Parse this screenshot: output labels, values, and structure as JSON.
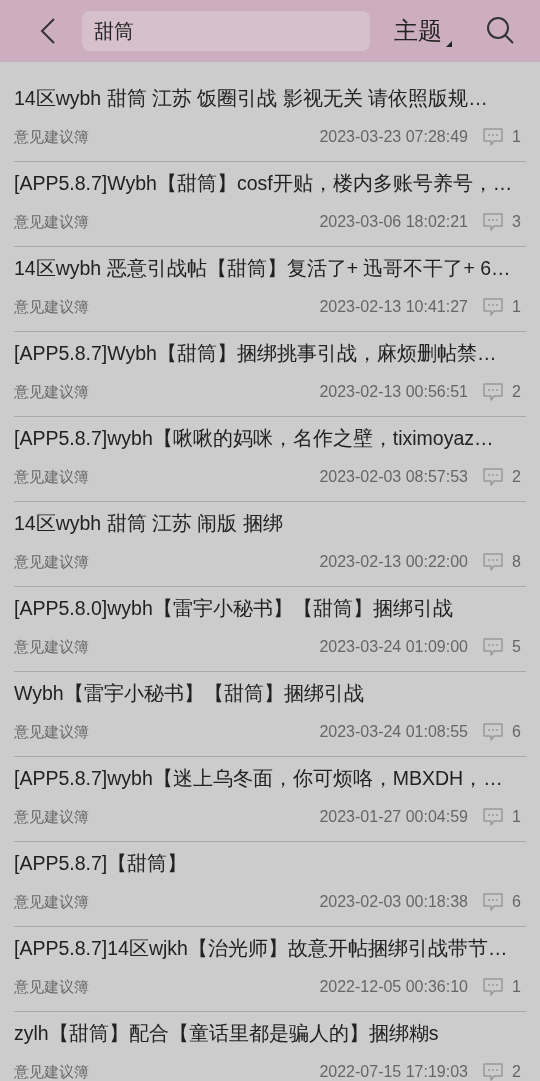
{
  "header": {
    "search_value": "甜筒",
    "filter": "主题"
  },
  "posts": [
    {
      "title": "14区wybh 甜筒 江苏 饭圈引战 影视无关 请依照版规…",
      "board": "意见建议簿",
      "time": "2023-03-23 07:28:49",
      "replies": "1"
    },
    {
      "title": "[APP5.8.7]Wybh【甜筒】cosf开贴，楼内多账号养号，…",
      "board": "意见建议簿",
      "time": "2023-03-06 18:02:21",
      "replies": "3"
    },
    {
      "title": "14区wybh 恶意引战帖【甜筒】复活了+ 迅哥不干了+ 6…",
      "board": "意见建议簿",
      "time": "2023-02-13 10:41:27",
      "replies": "1"
    },
    {
      "title": "[APP5.8.7]Wybh【甜筒】捆绑挑事引战，麻烦删帖禁…",
      "board": "意见建议簿",
      "time": "2023-02-13 00:56:51",
      "replies": "2"
    },
    {
      "title": "[APP5.8.7]wybh【啾啾的妈咪，名作之壁，tiximoyaz…",
      "board": "意见建议簿",
      "time": "2023-02-03 08:57:53",
      "replies": "2"
    },
    {
      "title": "14区wybh 甜筒 江苏 闹版 捆绑",
      "board": "意见建议簿",
      "time": "2023-02-13 00:22:00",
      "replies": "8"
    },
    {
      "title": "[APP5.8.0]wybh【雷宇小秘书】【甜筒】捆绑引战",
      "board": "意见建议簿",
      "time": "2023-03-24 01:09:00",
      "replies": "5"
    },
    {
      "title": "Wybh【雷宇小秘书】【甜筒】捆绑引战",
      "board": "意见建议簿",
      "time": "2023-03-24 01:08:55",
      "replies": "6"
    },
    {
      "title": "[APP5.8.7]wybh【迷上乌冬面，你可烦咯，MBXDH，…",
      "board": "意见建议簿",
      "time": "2023-01-27 00:04:59",
      "replies": "1"
    },
    {
      "title": "[APP5.8.7]【甜筒】",
      "board": "意见建议簿",
      "time": "2023-02-03 00:18:38",
      "replies": "6"
    },
    {
      "title": "[APP5.8.7]14区wjkh【治光师】故意开帖捆绑引战带节…",
      "board": "意见建议簿",
      "time": "2022-12-05 00:36:10",
      "replies": "1"
    },
    {
      "title": "zylh【甜筒】配合【童话里都是骗人的】捆绑糊s",
      "board": "意见建议簿",
      "time": "2022-07-15 17:19:03",
      "replies": "2"
    }
  ]
}
